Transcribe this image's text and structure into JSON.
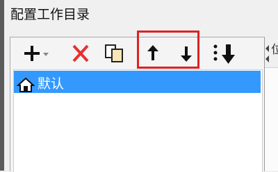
{
  "window": {
    "title": "配置工作目录"
  },
  "toolbar": {
    "add_icon": "plus-dropdown-icon",
    "delete_icon": "red-x-icon",
    "copy_icon": "copy-icon",
    "move_up_icon": "arrow-up-icon",
    "move_down_icon": "arrow-down-icon",
    "sort_icon": "list-sort-down-icon",
    "highlight_color": "#e02020"
  },
  "directories": [
    {
      "label": "默认",
      "icon": "home-icon",
      "selected": true
    }
  ],
  "selection_color": "#3399ff",
  "right_panel": {
    "label_fragment": "位"
  }
}
